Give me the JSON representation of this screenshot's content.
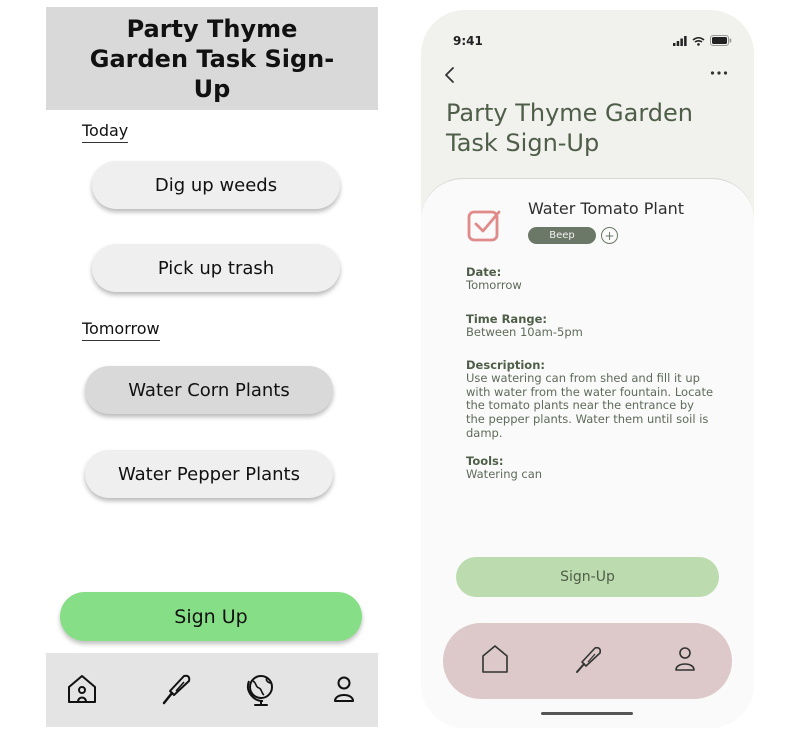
{
  "left": {
    "title": "Party Thyme Garden Task Sign-Up",
    "sections": [
      {
        "label": "Today",
        "tasks": [
          {
            "label": "Dig up weeds",
            "selected": false
          },
          {
            "label": "Pick up trash",
            "selected": false
          }
        ]
      },
      {
        "label": "Tomorrow",
        "tasks": [
          {
            "label": "Water Corn Plants",
            "selected": true
          },
          {
            "label": "Water Pepper Plants",
            "selected": false
          }
        ]
      }
    ],
    "signup_label": "Sign Up",
    "nav": [
      "home-icon",
      "trowel-icon",
      "globe-icon",
      "profile-icon"
    ]
  },
  "right": {
    "status_time": "9:41",
    "title": "Party Thyme Garden Task Sign-Up",
    "task": {
      "title": "Water Tomato Plant",
      "tag": "Beep",
      "add_tag": "+",
      "fields": [
        {
          "label": "Date:",
          "value": "Tomorrow"
        },
        {
          "label": "Time Range:",
          "value": "Between 10am-5pm"
        },
        {
          "label": "Description:",
          "value": "Use watering can from shed and fill it up with water from the water fountain. Locate the tomato  plants near the entrance by the pepper plants. Water them until soil is damp."
        },
        {
          "label": "Tools:",
          "value": "Watering can"
        }
      ]
    },
    "signup_label": "Sign-Up",
    "nav": [
      "home-icon",
      "trowel-icon",
      "profile-icon"
    ]
  },
  "colors": {
    "accent_green": "#86df86",
    "header_gray": "#d9d9d9",
    "phone_text_green": "#4f5e48",
    "phone_button": "#bcdcaf",
    "phone_nav": "#ddc9c9",
    "checkbox": "#e08a8a"
  }
}
